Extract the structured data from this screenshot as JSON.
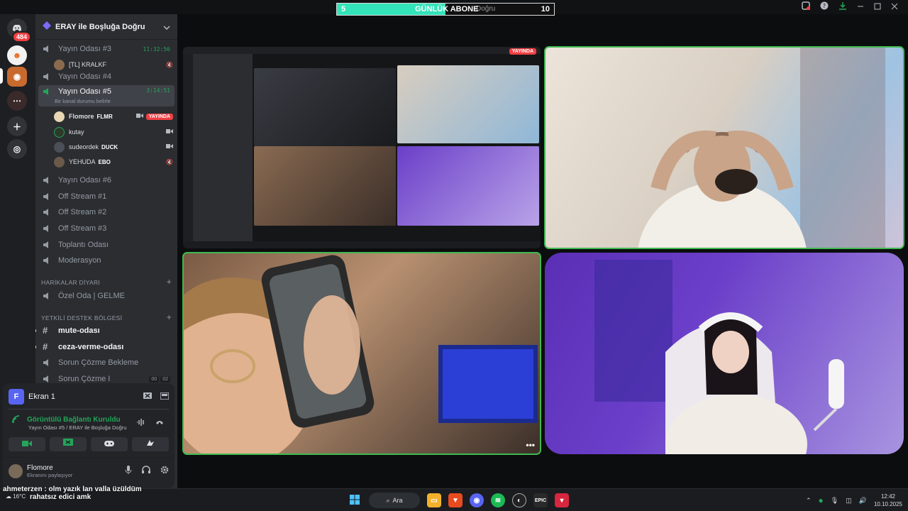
{
  "overlay": {
    "abone_left": "5",
    "abone_label": "GÜNLÜK ABONE",
    "abone_behind": "Doğru",
    "abone_right": "10",
    "abone_progress": 0.5
  },
  "rail": {
    "badge": "484",
    "accent": "#5865f2"
  },
  "server": {
    "name": "ERAY ile Boşluğa Doğru"
  },
  "channels": [
    {
      "name": "Yayın Odası #3",
      "time": "11:32:56"
    },
    {
      "name": "Yayın Odası #4"
    },
    {
      "name": "Yayın Odası #5",
      "time": "3:14:51",
      "status": "Bir kanal durumu belirle"
    },
    {
      "name": "Yayın Odası #6"
    },
    {
      "name": "Off Stream #1"
    },
    {
      "name": "Off Stream #2"
    },
    {
      "name": "Off Stream #3"
    },
    {
      "name": "Toplantı Odası"
    },
    {
      "name": "Moderasyon"
    },
    {
      "name": "Özel Oda | GELME"
    },
    {
      "name": "mute-odası"
    },
    {
      "name": "ceza-verme-odası"
    },
    {
      "name": "Sorun Çözme Bekleme"
    },
    {
      "name": "Sorun Çözme I",
      "count_a": "00",
      "count_b": "02"
    }
  ],
  "voice_users": [
    {
      "name": "[TL] KRALKF"
    },
    {
      "name": "Flomore",
      "tag": "FLMR",
      "live": "YAYINDA"
    },
    {
      "name": "kutay"
    },
    {
      "name": "sudeordek",
      "tag": "DUCK"
    },
    {
      "name": "YEHUDA",
      "tag": "EBO"
    }
  ],
  "categories": [
    {
      "name": "HARİKALAR DİYARI"
    },
    {
      "name": "YETKİLİ DESTEK BÖLGESİ"
    }
  ],
  "voice_panel": {
    "screen_initial": "F",
    "screen_name": "Ekran 1",
    "connection": "Görüntülü Bağlantı Kuruldu",
    "location": "Yayın Odası #5 / ERAY ile Boşluğa Doğru",
    "user": "Flomore",
    "user_status": "Ekranını paylaşıyor"
  },
  "stream_tiles": [
    {
      "id": "screen-share",
      "speaking": false,
      "colors": [
        "#3a3c44",
        "#1a1b1e"
      ],
      "live": "YAYINDA"
    },
    {
      "id": "cam-man",
      "speaking": true,
      "colors": [
        "#d8cdbf",
        "#8fb7d8"
      ]
    },
    {
      "id": "cam-phone",
      "speaking": true,
      "colors": [
        "#8a6b52",
        "#3a2e28"
      ]
    },
    {
      "id": "cam-girl",
      "speaking": false,
      "colors": [
        "#6b3fc9",
        "#b9a3e8"
      ]
    }
  ],
  "chat": [
    {
      "user": "ahmeterzen",
      "text": "olm yazık lan valla üzüldüm"
    },
    {
      "user": "",
      "text": "rahatsız edici amk"
    }
  ],
  "taskbar": {
    "search": "Ara",
    "weather": "16°C",
    "time": "12:42",
    "date": "10.10.2025"
  }
}
